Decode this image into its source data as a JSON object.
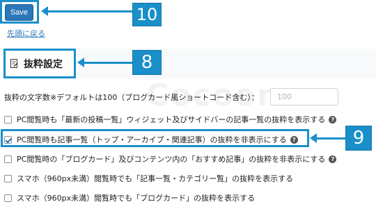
{
  "toolbar": {
    "save_label": "Save"
  },
  "nav": {
    "back_to_top": "先頭に戻る"
  },
  "section": {
    "title": "抜粋設定",
    "watermark": "Cocoon"
  },
  "callouts": {
    "save": "10",
    "section": "8",
    "highlight": "9"
  },
  "excerpt_length": {
    "label": "抜粋の文字数※デフォルトは100（ブログカード風ショートコード含む）：",
    "placeholder": "100"
  },
  "options": [
    {
      "label": "PC閲覧時も「最新の投稿一覧」ウィジェット及びサイドバーの記事一覧の抜粋を表示する",
      "checked": false,
      "help": "?"
    },
    {
      "label": "PC閲覧時も記事一覧（トップ・アーカイブ・関連記事）の抜粋を非表示にする",
      "checked": true,
      "help": "?"
    },
    {
      "label": "PC閲覧時の「ブログカード」及びコンテンツ内の「おすすめ記事」の抜粋を非表示にする",
      "checked": false,
      "help": "?"
    },
    {
      "label": "スマホ（960px未満）閲覧時でも「記事一覧・カテゴリー覧」の抜粋を表示する",
      "checked": false,
      "help": ""
    },
    {
      "label": "スマホ（960px未満）閲覧時でも「ブログカード」の抜粋を表示する",
      "checked": false,
      "help": ""
    }
  ],
  "colors": {
    "accent": "#1a8fc9",
    "button": "#2b78b8"
  }
}
